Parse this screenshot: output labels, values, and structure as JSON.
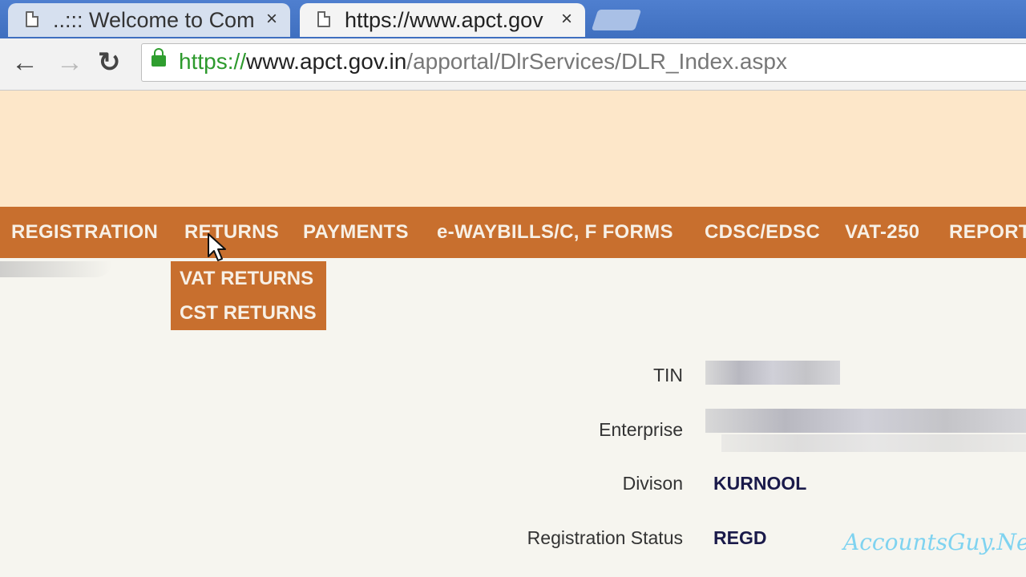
{
  "browser": {
    "tabs": [
      {
        "title": "..::: Welcome to Com",
        "active": false
      },
      {
        "title": "https://www.apct.gov",
        "active": true
      }
    ],
    "close_glyph": "×",
    "address": {
      "scheme": "https://",
      "host": "www.apct.gov.in",
      "path": "/apportal/DlrServices/DLR_Index.aspx"
    }
  },
  "menu": {
    "items": [
      "REGISTRATION",
      "RETURNS",
      "PAYMENTS",
      "e-WAYBILLS/C, F FORMS",
      "CDSC/EDSC",
      "VAT-250",
      "REPORT"
    ],
    "dropdown": [
      "VAT RETURNS",
      "CST RETURNS"
    ],
    "bar_color": "#c86f2e"
  },
  "details": {
    "tin_label": "TIN",
    "enterprise_label": "Enterprise",
    "division_label": "Divison",
    "division_value": "KURNOOL",
    "status_label": "Registration Status",
    "status_value": "REGD"
  },
  "watermark": "AccountsGuy.Net",
  "icons": {
    "back": "back-arrow-icon",
    "forward": "forward-arrow-icon",
    "reload": "reload-icon",
    "lock": "lock-icon",
    "page": "page-icon",
    "cursor": "mouse-pointer-icon"
  }
}
